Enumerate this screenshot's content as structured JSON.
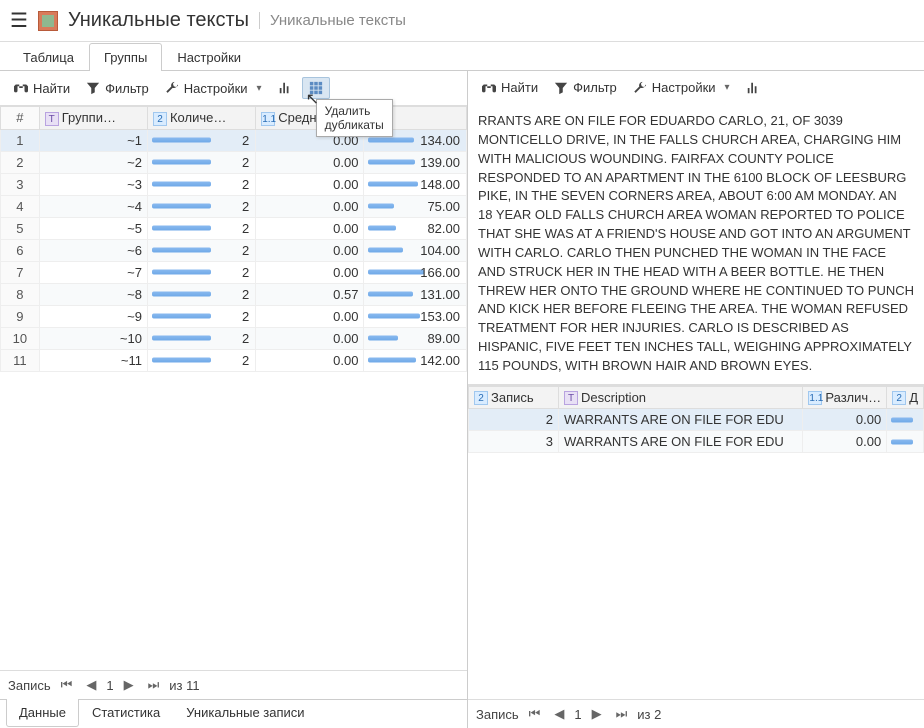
{
  "title": "Уникальные тексты",
  "subtitle": "Уникальные тексты",
  "mainTabs": [
    "Таблица",
    "Группы",
    "Настройки"
  ],
  "mainTabActive": 1,
  "toolbarLeft": {
    "find": "Найти",
    "filter": "Фильтр",
    "settings": "Настройки"
  },
  "toolbarRight": {
    "find": "Найти",
    "filter": "Фильтр",
    "settings": "Настройки"
  },
  "tooltip": "Удалить дубликаты",
  "leftGrid": {
    "headers": {
      "num": "#",
      "group": "Группи…",
      "count": "Количе…",
      "avg": "Средне…",
      "last": ""
    },
    "rows": [
      {
        "n": 1,
        "g": "~1",
        "c": 2,
        "a": "0.00",
        "v": 134.0
      },
      {
        "n": 2,
        "g": "~2",
        "c": 2,
        "a": "0.00",
        "v": 139.0
      },
      {
        "n": 3,
        "g": "~3",
        "c": 2,
        "a": "0.00",
        "v": 148.0
      },
      {
        "n": 4,
        "g": "~4",
        "c": 2,
        "a": "0.00",
        "v": 75.0
      },
      {
        "n": 5,
        "g": "~5",
        "c": 2,
        "a": "0.00",
        "v": 82.0
      },
      {
        "n": 6,
        "g": "~6",
        "c": 2,
        "a": "0.00",
        "v": 104.0
      },
      {
        "n": 7,
        "g": "~7",
        "c": 2,
        "a": "0.00",
        "v": 166.0
      },
      {
        "n": 8,
        "g": "~8",
        "c": 2,
        "a": "0.57",
        "v": 131.0
      },
      {
        "n": 9,
        "g": "~9",
        "c": 2,
        "a": "0.00",
        "v": 153.0
      },
      {
        "n": 10,
        "g": "~10",
        "c": 2,
        "a": "0.00",
        "v": 89.0
      },
      {
        "n": 11,
        "g": "~11",
        "c": 2,
        "a": "0.00",
        "v": 142.0
      }
    ],
    "maxV": 166
  },
  "leftPager": {
    "label": "Запись",
    "page": "1",
    "of": "из 11"
  },
  "bottomTabs": [
    "Данные",
    "Статистика",
    "Уникальные записи"
  ],
  "bottomActive": 0,
  "detailText": "RRANTS ARE ON FILE FOR EDUARDO CARLO, 21, OF 3039 MONTICELLO DRIVE, IN THE FALLS CHURCH AREA, CHARGING HIM WITH MALICIOUS WOUNDING. FAIRFAX COUNTY POLICE RESPONDED TO AN APARTMENT IN THE 6100 BLOCK OF LEESBURG PIKE, IN THE SEVEN CORNERS AREA, ABOUT 6:00 AM MONDAY. AN 18 YEAR OLD FALLS CHURCH AREA WOMAN REPORTED TO POLICE THAT SHE WAS AT A FRIEND'S HOUSE AND GOT INTO AN ARGUMENT WITH CARLO. CARLO THEN PUNCHED THE WOMAN IN THE FACE AND STRUCK HER IN THE HEAD WITH A BEER BOTTLE. HE THEN THREW HER ONTO THE GROUND WHERE HE CONTINUED TO PUNCH AND KICK HER BEFORE FLEEING THE AREA. THE WOMAN REFUSED TREATMENT FOR HER INJURIES. CARLO IS DESCRIBED AS HISPANIC, FIVE FEET TEN INCHES TALL, WEIGHING APPROXIMATELY 115 POUNDS, WITH BROWN HAIR AND BROWN EYES.",
  "rightGrid": {
    "headers": {
      "rec": "Запись",
      "desc": "Description",
      "diff": "Различ…",
      "last": "Д"
    },
    "rows": [
      {
        "rec": 2,
        "desc": "WARRANTS ARE ON FILE FOR EDU",
        "diff": "0.00"
      },
      {
        "rec": 3,
        "desc": "WARRANTS ARE ON FILE FOR EDU",
        "diff": "0.00"
      }
    ]
  },
  "rightPager": {
    "label": "Запись",
    "page": "1",
    "of": "из 2"
  }
}
